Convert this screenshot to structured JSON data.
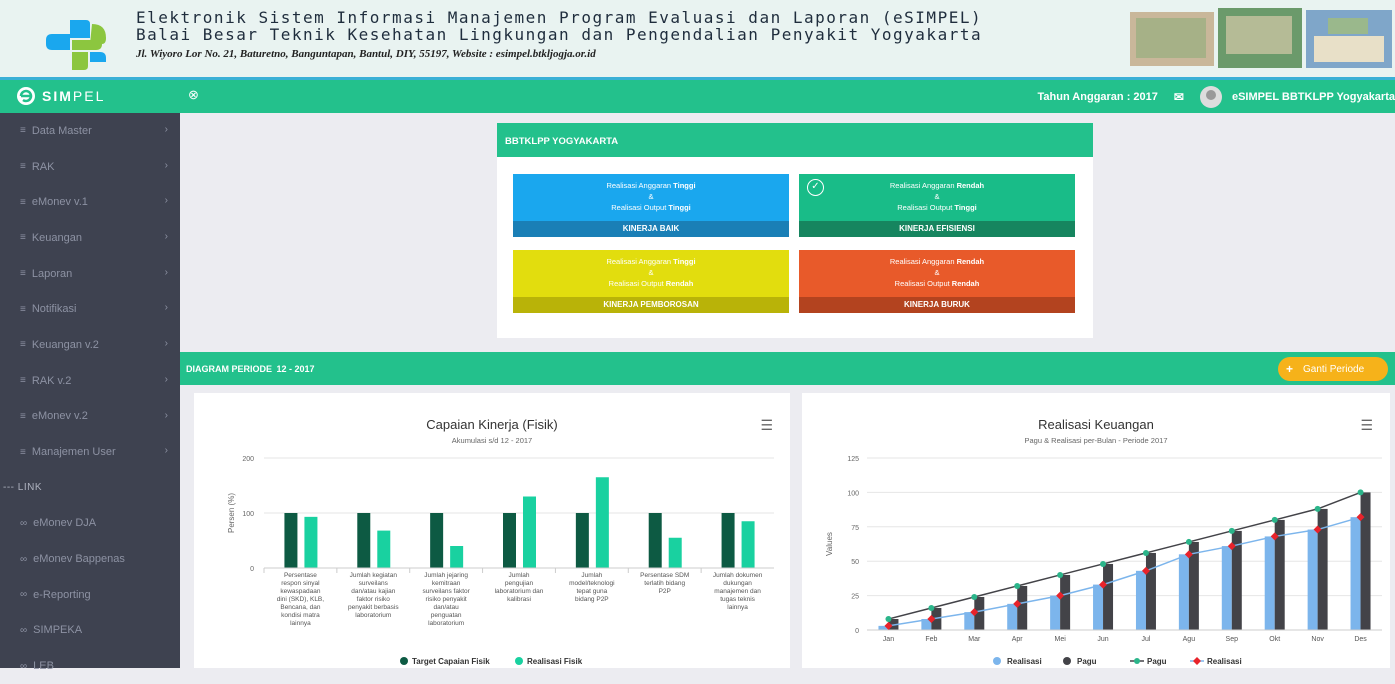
{
  "banner": {
    "line1": "Elektronik Sistem Informasi Manajemen Program Evaluasi dan Laporan (eSIMPEL)",
    "line2": "Balai Besar Teknik Kesehatan Lingkungan dan Pengendalian Penyakit Yogyakarta",
    "address": "Jl. Wiyoro Lor No. 21, Baturetno, Banguntapan, Bantul, DIY, 55197,   Website : esimpel.btkljogja.or.id"
  },
  "topbar": {
    "brand_bold": "SIM",
    "brand_lite": "PEL",
    "year_label": "Tahun Anggaran : 2017",
    "user_name": "eSIMPEL BBTKLPP Yogyakarta",
    "colors": {
      "primary": "#23c18c",
      "sidebar": "#3e4250",
      "accent": "#f6b21a"
    }
  },
  "sidebar": {
    "items": [
      "Data Master",
      "RAK",
      "eMonev v.1",
      "Keuangan",
      "Laporan",
      "Notifikasi",
      "Keuangan v.2",
      "RAK v.2",
      "eMonev v.2",
      "Manajemen User"
    ],
    "link_header": "--- LINK",
    "links": [
      "eMonev DJA",
      "eMonev Bappenas",
      "e-Reporting",
      "SIMPEKA",
      "LEB"
    ]
  },
  "kinerja": {
    "header": "BBTKLPP YOGYAKARTA",
    "and": "&",
    "boxes": [
      {
        "l1a": "Realisasi Anggaran ",
        "l1b": "Tinggi",
        "l2a": "Realisasi Output ",
        "l2b": "Tinggi",
        "footer": "KINERJA BAIK"
      },
      {
        "l1a": "Realisasi Anggaran ",
        "l1b": "Rendah",
        "l2a": "Realisasi Output ",
        "l2b": "Tinggi",
        "footer": "KINERJA EFISIENSI",
        "checked": true
      },
      {
        "l1a": "Realisasi Anggaran ",
        "l1b": "Tinggi",
        "l2a": "Realisasi Output ",
        "l2b": "Rendah",
        "footer": "KINERJA PEMBOROSAN"
      },
      {
        "l1a": "Realisasi Anggaran ",
        "l1b": "Rendah",
        "l2a": "Realisasi Output ",
        "l2b": "Rendah",
        "footer": "KINERJA BURUK"
      }
    ]
  },
  "periode": {
    "label": "DIAGRAM PERIODE ",
    "value": "12 - 2017",
    "button": "Ganti Periode"
  },
  "chart_data": [
    {
      "type": "bar",
      "title": "Capaian Kinerja (Fisik)",
      "subtitle": "Akumulasi s/d 12 - 2017",
      "ylabel": "Persen (%)",
      "ylim": [
        0,
        200
      ],
      "yticks": [
        0,
        100,
        200
      ],
      "categories": [
        [
          "Persentase",
          "respon sinyal",
          "kewaspadaan",
          "dini (SKD), KLB,",
          "Bencana, dan",
          "kondisi matra",
          "lainnya"
        ],
        [
          "Jumlah kegiatan",
          "surveilans",
          "dan/atau kajian",
          "faktor risiko",
          "penyakit berbasis",
          "laboratorium"
        ],
        [
          "Jumlah jejaring",
          "kemitraan",
          "surveilans faktor",
          "risiko penyakit",
          "dan/atau",
          "penguatan",
          "laboratorium"
        ],
        [
          "Jumlah",
          "pengujian",
          "laboratorium dan",
          "kalibrasi"
        ],
        [
          "Jumlah",
          "model/teknologi",
          "tepat guna",
          "bidang P2P"
        ],
        [
          "Persentase SDM",
          "terlatih bidang",
          "P2P"
        ],
        [
          "Jumlah dokumen",
          "dukungan",
          "manajemen dan",
          "tugas teknis",
          "lainnya"
        ]
      ],
      "series": [
        {
          "name": "Target Capaian Fisik",
          "color": "#0d5a43",
          "values": [
            100,
            100,
            100,
            100,
            100,
            100,
            100
          ]
        },
        {
          "name": "Realisasi Fisik",
          "color": "#19d1a0",
          "values": [
            93,
            68,
            40,
            130,
            165,
            55,
            85
          ]
        }
      ],
      "grid": true,
      "legend": "bottom"
    },
    {
      "type": "bar",
      "title": "Realisasi Keuangan",
      "subtitle": "Pagu & Realisasi per-Bulan - Periode 2017",
      "ylabel": "Values",
      "ylim": [
        0,
        125
      ],
      "yticks": [
        0,
        25,
        50,
        75,
        100,
        125
      ],
      "categories": [
        "Jan",
        "Feb",
        "Mar",
        "Apr",
        "Mei",
        "Jun",
        "Jul",
        "Agu",
        "Sep",
        "Okt",
        "Nov",
        "Des"
      ],
      "series": [
        {
          "name": "Realisasi",
          "kind": "bar",
          "color": "#7cb5ec",
          "values": [
            3,
            8,
            13,
            19,
            25,
            33,
            43,
            55,
            61,
            68,
            73,
            82
          ]
        },
        {
          "name": "Pagu",
          "kind": "bar",
          "color": "#434348",
          "values": [
            8,
            16,
            24,
            32,
            40,
            48,
            56,
            64,
            72,
            80,
            88,
            100
          ]
        },
        {
          "name": "Pagu",
          "kind": "line",
          "color": "#434348",
          "marker": "circle-green",
          "values": [
            8,
            16,
            24,
            32,
            40,
            48,
            56,
            64,
            72,
            80,
            88,
            100
          ]
        },
        {
          "name": "Realisasi",
          "kind": "line",
          "color": "#7cb5ec",
          "marker": "diamond-red",
          "values": [
            3,
            8,
            13,
            19,
            25,
            33,
            43,
            55,
            61,
            68,
            73,
            82
          ]
        }
      ],
      "grid": true,
      "legend": "bottom"
    }
  ]
}
